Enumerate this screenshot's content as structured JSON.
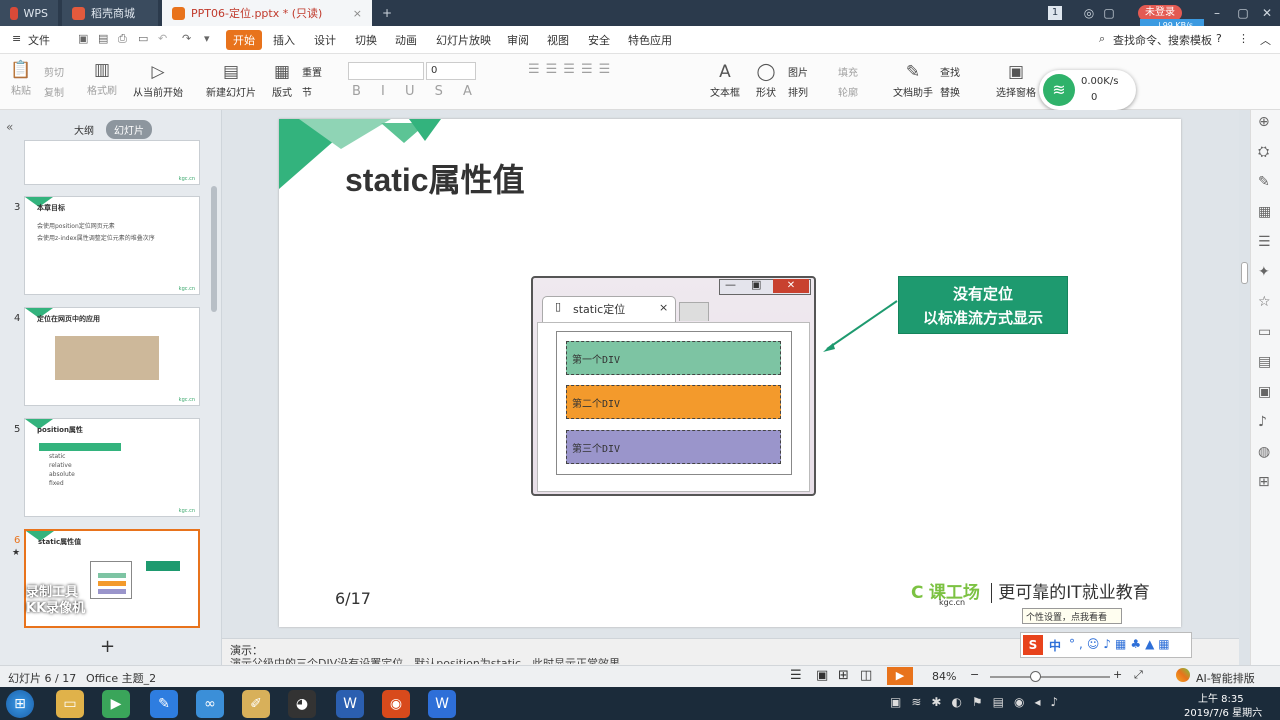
{
  "titlebar": {
    "tabs": [
      {
        "label": "WPS"
      },
      {
        "label": "稻壳商城"
      },
      {
        "label": "PPT06-定位.pptx * (只读)"
      }
    ],
    "badge": "1",
    "user_label": "未登录",
    "net_speed_top": "↓99 KB/s"
  },
  "menu": {
    "file": "文件",
    "items": [
      "开始",
      "插入",
      "设计",
      "切换",
      "动画",
      "幻灯片放映",
      "审阅",
      "视图",
      "安全",
      "特色应用"
    ],
    "search": "查找命令、搜索模板"
  },
  "ribbon": {
    "paste": "粘贴",
    "cut": "剪切",
    "copy": "复制",
    "format_painter": "格式刷",
    "play_from_current": "从当前开始",
    "new_slide": "新建幻灯片",
    "layout": "版式",
    "section": "节",
    "reset": "重置",
    "font_size": "0",
    "textbox": "文本框",
    "shape": "形状",
    "arrange": "排列",
    "picture": "图片",
    "fill": "填充",
    "outline": "轮廓",
    "doc_helper": "文档助手",
    "find": "查找",
    "replace": "替换",
    "select_pane": "选择窗格"
  },
  "network_widget": {
    "speed": "0.00K/s",
    "count": "0"
  },
  "left_pane": {
    "tabs": [
      "大纲",
      "幻灯片"
    ],
    "slides": [
      {
        "num": "",
        "title": "",
        "lines": []
      },
      {
        "num": "3",
        "title": "本章目标",
        "lines": [
          "会使用position定位网页元素",
          "会使用z-index属性调整定位元素的堆叠次序"
        ]
      },
      {
        "num": "4",
        "title": "定位在网页中的应用",
        "lines": []
      },
      {
        "num": "5",
        "title": "position属性",
        "lines": [
          "static",
          "relative",
          "absolute",
          "fixed"
        ]
      },
      {
        "num": "6",
        "title": "static属性值",
        "lines": []
      }
    ],
    "add": "+",
    "watermark_line1": "录制工具",
    "watermark_line2": "KK录像机"
  },
  "slide": {
    "title": "static属性值",
    "page": "6/17",
    "browser_tab": "static定位",
    "divs": [
      "第一个DIV",
      "第二个DIV",
      "第三个DIV"
    ],
    "div_colors": [
      "#7dc4a3",
      "#f39a2c",
      "#9a95cb"
    ],
    "callout_line1": "没有定位",
    "callout_line2": "以标准流方式显示",
    "logo_text": "课工场",
    "logo_sub": "kgc.cn",
    "slogan": "更可靠的IT就业教育"
  },
  "notes": {
    "label": "演示：",
    "text": "演示父级中的三个DIV没有设置定位，默认position为static，此时显示正常效果"
  },
  "status": {
    "slide_index": "幻灯片 6 / 17",
    "theme": "Office 主题_2",
    "zoom": "84%",
    "ai_layout": "AI-智能排版"
  },
  "ime": {
    "tooltip": "个性设置，点我看看",
    "lang": "中"
  },
  "taskbar": {
    "time": "上午 8:35",
    "date": "2019/7/6 星期六"
  },
  "colors": {
    "accent": "#e8731c",
    "brand_green": "#33b37d",
    "callout": "#1e9a6f"
  }
}
